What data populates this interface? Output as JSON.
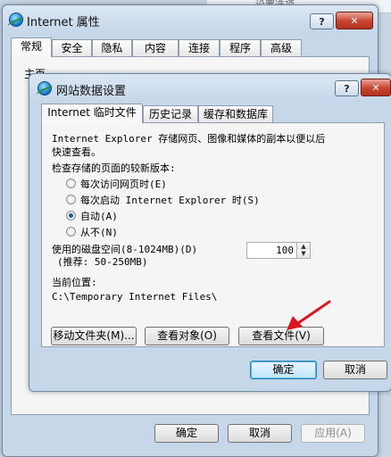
{
  "bg_header_text": "设置选项",
  "outer": {
    "title": "Internet 属性",
    "help_label": "?",
    "close_label": "✕",
    "tabs": [
      "常规",
      "安全",
      "隐私",
      "内容",
      "连接",
      "程序",
      "高级"
    ],
    "partial_text": "主页",
    "ok_label": "确定",
    "cancel_label": "取消",
    "apply_label": "应用(A)"
  },
  "inner": {
    "title": "网站数据设置",
    "help_label": "?",
    "close_label": "✕",
    "tabs": [
      "Internet 临时文件",
      "历史记录",
      "缓存和数据库"
    ],
    "description_line1": "Internet Explorer 存储网页、图像和媒体的副本以便以后",
    "description_line2": "快速查看。",
    "check_label": "检查存储的页面的较新版本:",
    "options": [
      {
        "label": "每次访问网页时(E)",
        "checked": false
      },
      {
        "label": "每次启动 Internet Explorer 时(S)",
        "checked": false
      },
      {
        "label": "自动(A)",
        "checked": true
      },
      {
        "label": "从不(N)",
        "checked": false
      }
    ],
    "disk_label": "使用的磁盘空间(8-1024MB)(D)",
    "disk_hint": "(推荐: 50-250MB)",
    "disk_value": "100",
    "location_label": "当前位置:",
    "location_path": "C:\\Temporary Internet Files\\",
    "move_button": "移动文件夹(M)...",
    "view_objects_button": "查看对象(O)",
    "view_files_button": "查看文件(V)",
    "ok_label": "确定",
    "cancel_label": "取消"
  },
  "colors": {
    "annotation_arrow": "#e0141e",
    "default_button_border": "#3c7fb1"
  }
}
